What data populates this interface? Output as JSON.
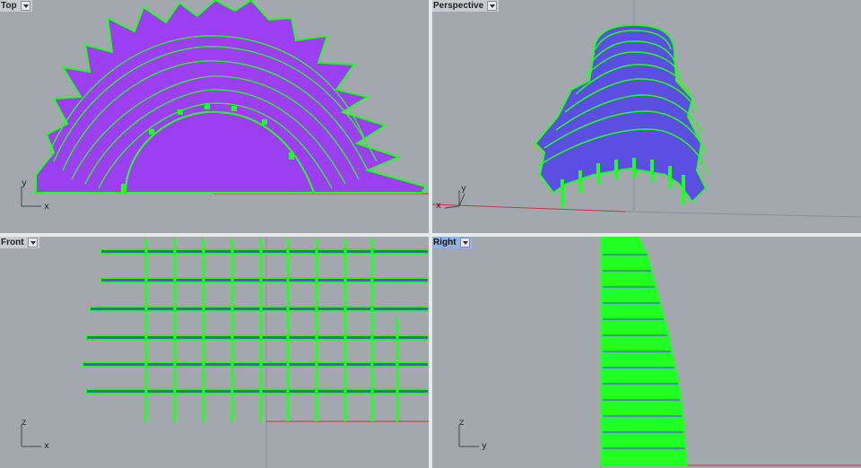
{
  "viewports": {
    "top": {
      "label": "Top",
      "axis_h": "x",
      "axis_v": "y"
    },
    "perspective": {
      "label": "Perspective",
      "axis_h": "x",
      "axis_v": "y"
    },
    "front": {
      "label": "Front",
      "axis_h": "x",
      "axis_v": "z"
    },
    "right": {
      "label": "Right",
      "axis_h": "y",
      "axis_v": "z"
    }
  },
  "colors": {
    "viewport_bg": "#a3a8ae",
    "viewport_border": "#e9e9e9",
    "active_tab": "#8fb2e6",
    "geometry_fill_top": "#9b3ff0",
    "geometry_fill_perspective": "#5a4fe0",
    "geometry_edges": "#22ff22",
    "grid_x_axis": "#b04040",
    "grid_y_axis": "#3a9a3a"
  },
  "icons": {
    "viewport_menu": "chevron-down-icon",
    "axis_gizmo": "axis-triad-icon"
  },
  "active_viewport": "right"
}
